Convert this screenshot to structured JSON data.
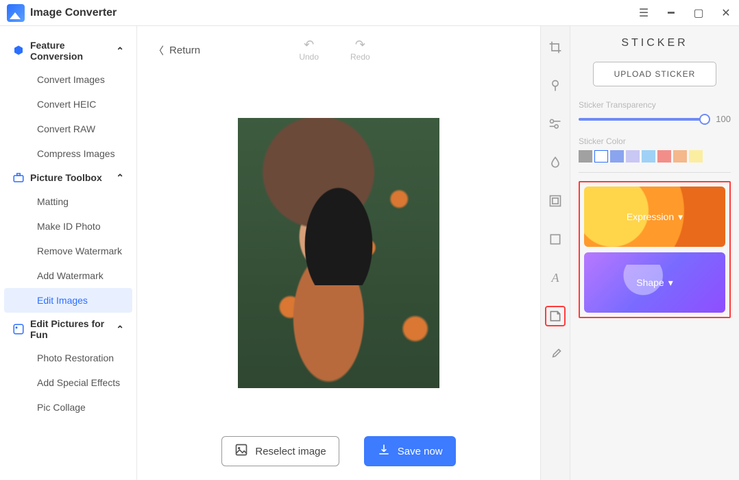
{
  "app": {
    "title": "Image Converter"
  },
  "sidebar": {
    "sections": [
      {
        "label": "Feature Conversion",
        "items": [
          "Convert Images",
          "Convert HEIC",
          "Convert RAW",
          "Compress Images"
        ]
      },
      {
        "label": "Picture Toolbox",
        "items": [
          "Matting",
          "Make ID Photo",
          "Remove Watermark",
          "Add Watermark",
          "Edit Images"
        ]
      },
      {
        "label": "Edit Pictures for Fun",
        "items": [
          "Photo Restoration",
          "Add Special Effects",
          "Pic Collage"
        ]
      }
    ],
    "active": "Edit Images"
  },
  "editor": {
    "return_label": "Return",
    "undo_label": "Undo",
    "redo_label": "Redo",
    "reselect_label": "Reselect image",
    "save_label": "Save now"
  },
  "tool_icons": [
    "crop",
    "levels",
    "adjust",
    "drop",
    "frame",
    "size",
    "text",
    "sticker",
    "eyedropper"
  ],
  "tool_active": "sticker",
  "sticker_panel": {
    "title": "STICKER",
    "upload_label": "UPLOAD STICKER",
    "transparency_label": "Sticker Transparency",
    "transparency_value": 100,
    "color_label": "Sticker Color",
    "swatches": [
      "#a1a1a1",
      "#ffffff",
      "#8aa4ef",
      "#c9c7f3",
      "#9fd1f6",
      "#f28e8a",
      "#f4b88b",
      "#fbeea0"
    ],
    "swatch_selected": 1,
    "categories": [
      {
        "id": "expression",
        "label": "Expression"
      },
      {
        "id": "shape",
        "label": "Shape"
      }
    ]
  }
}
